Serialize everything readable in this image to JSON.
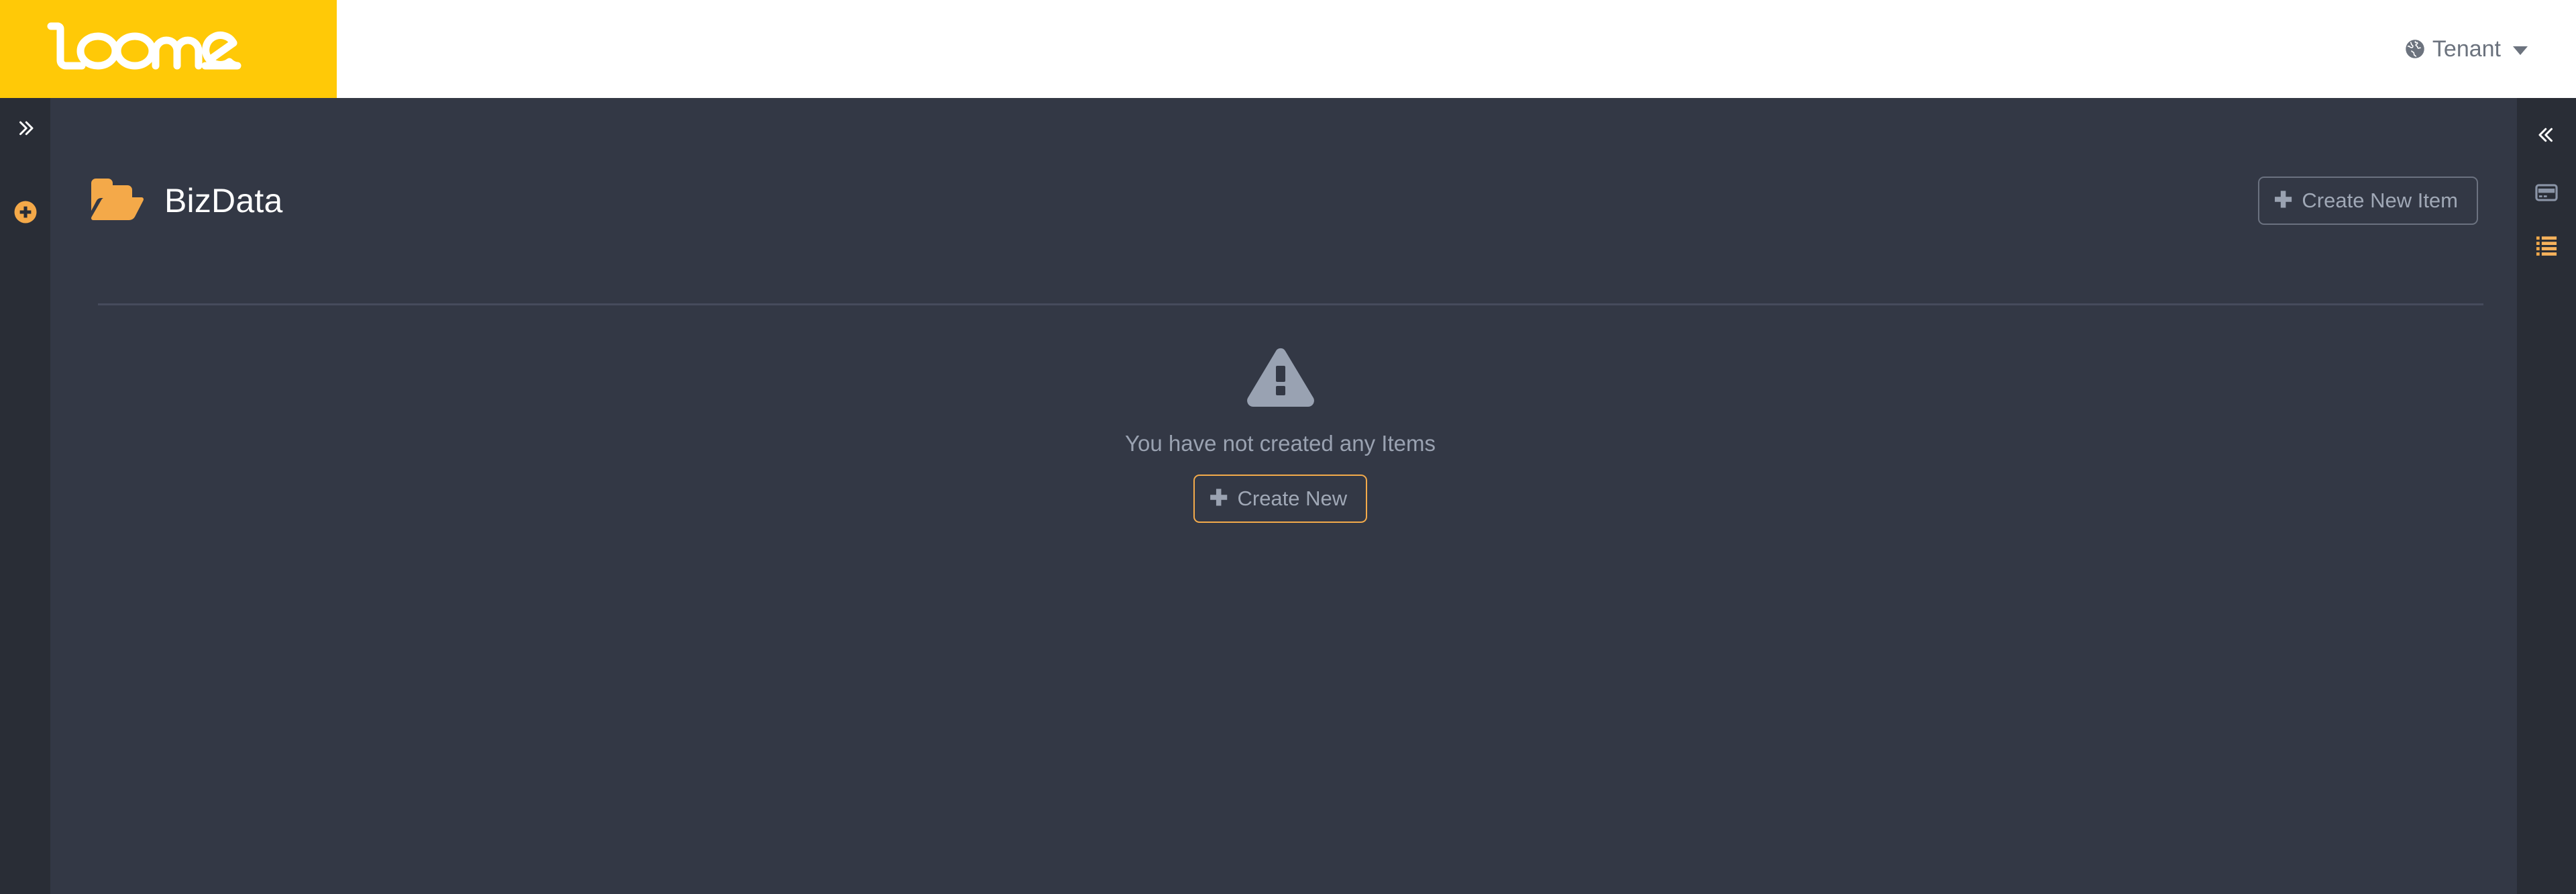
{
  "app": {
    "logo_text": "loome",
    "logo_bg": "#ffc907"
  },
  "topbar": {
    "tenant_label": "Tenant",
    "tenant_icon": "globe-icon",
    "caret_icon": "chevron-down-icon"
  },
  "left_rail": {
    "expand_icon": "chevron-double-right-icon",
    "add_icon": "plus-circle-icon",
    "add_color": "#f4a949"
  },
  "page": {
    "folder_icon": "open-folder-icon",
    "folder_color": "#f4a949",
    "title": "BizData",
    "create_new_item_label": "Create New Item",
    "create_new_item_icon": "plus-icon"
  },
  "empty_state": {
    "icon": "warning-triangle-icon",
    "icon_color": "#99a2b2",
    "message": "You have not created any Items",
    "create_new_label": "Create New",
    "create_new_icon": "plus-icon",
    "accent_color": "#f4ab4b"
  },
  "right_rail": {
    "items": [
      {
        "icon": "chevron-double-left-icon",
        "color": "#ffffff"
      },
      {
        "icon": "credit-card-icon",
        "color": "#8a94a6"
      },
      {
        "icon": "task-list-icon",
        "color": "#f0a84a"
      }
    ]
  },
  "colors": {
    "rail_bg": "#292d36",
    "main_bg": "#333845",
    "divider": "#464b5c",
    "muted_text": "#9aa2b1",
    "brand_yellow": "#ffc907",
    "accent_orange": "#f4a949"
  }
}
